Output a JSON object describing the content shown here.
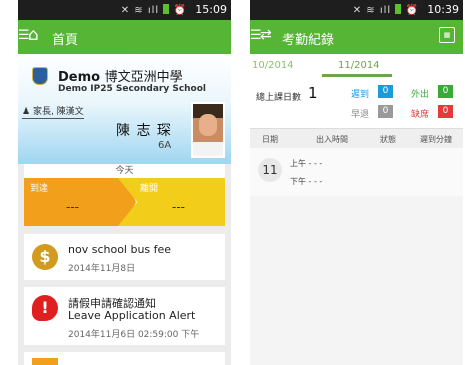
{
  "phone1": {
    "status": {
      "time": "15:09"
    },
    "title": "首頁",
    "school": {
      "name_en": "Demo",
      "name_zh": "博文亞洲中學",
      "sub": "Demo IP25 Secondary School"
    },
    "parent": "家長, 陳漢文",
    "student": {
      "name": "陳 志 琛",
      "class": "6A"
    },
    "today": {
      "label": "今天",
      "arrive_label": "到達",
      "leave_label": "離開",
      "arrive_value": "---",
      "leave_value": "---"
    },
    "notices": [
      {
        "title": "nov school bus fee",
        "date": "2014年11月8日",
        "icon": "dollar-icon",
        "color": "#d29a1e"
      },
      {
        "title": "請假申請確認通知",
        "subtitle": "Leave Application Alert",
        "date": "2014年11月6日 02:59:00 下午",
        "icon": "alert-speech-icon",
        "color": "#e02020"
      }
    ]
  },
  "phone2": {
    "status": {
      "time": "10:39"
    },
    "title": "考勤紀錄",
    "prev_month": "10/2014",
    "cur_month": "11/2014",
    "total_label": "總上課日數",
    "total_value": "1",
    "stats": [
      {
        "label": "遲到",
        "value": "0",
        "color": "#1e9ad6"
      },
      {
        "label": "外出",
        "value": "0",
        "color": "#3aa93a"
      },
      {
        "label": "早退",
        "value": "0",
        "color": "#9a9a9a"
      },
      {
        "label": "缺席",
        "value": "0",
        "color": "#e23b3b"
      }
    ],
    "headers": [
      "日期",
      "出入時間",
      "狀態",
      "遲到分鐘"
    ],
    "record": {
      "day": "11",
      "am": "上午 - - -",
      "pm": "下午 - - -"
    }
  }
}
